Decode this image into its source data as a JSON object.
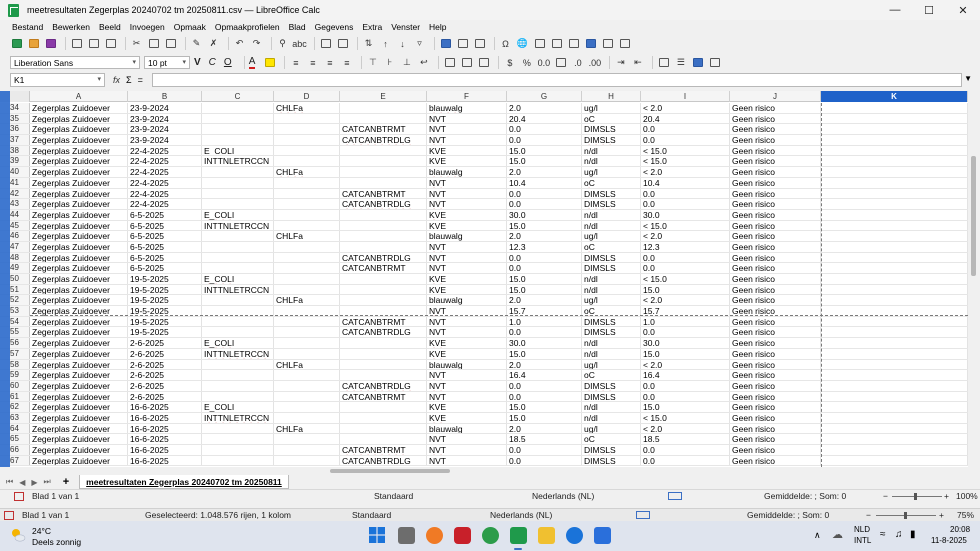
{
  "window": {
    "title": "meetresultaten Zegerplas 20240702 tm 20250811.csv — LibreOffice Calc",
    "controls": {
      "minimize": "—",
      "maximize": "☐",
      "close": "✕"
    }
  },
  "menubar": [
    "Bestand",
    "Bewerken",
    "Beeld",
    "Invoegen",
    "Opmaak",
    "Opmaakprofielen",
    "Blad",
    "Gegevens",
    "Extra",
    "Venster",
    "Help"
  ],
  "toolbar": {
    "font_name": "Liberation Sans",
    "font_size": "10 pt",
    "bold": "V",
    "italic": "C",
    "underline": "O",
    "font_color_letter": "A"
  },
  "formula_bar": {
    "name_box": "K1",
    "fx": "fx",
    "sigma": "Σ",
    "equals": "=",
    "content": ""
  },
  "grid": {
    "columns": [
      "A",
      "B",
      "C",
      "D",
      "E",
      "F",
      "G",
      "H",
      "I",
      "J",
      "K"
    ],
    "selected_column": "K",
    "rows": [
      {
        "n": "34",
        "a": "Zegerplas Zuidoever",
        "b": "23-9-2024",
        "c": "",
        "d": "CHLFa",
        "e": "",
        "f": "blauwalg",
        "g": "2.0",
        "h": "ug/l",
        "i": "< 2.0",
        "j": "Geen risico"
      },
      {
        "n": "35",
        "a": "Zegerplas Zuidoever",
        "b": "23-9-2024",
        "c": "",
        "d": "",
        "e": "",
        "f": "NVT",
        "g": "20.4",
        "h": "oC",
        "i": "20.4",
        "j": "Geen risico"
      },
      {
        "n": "36",
        "a": "Zegerplas Zuidoever",
        "b": "23-9-2024",
        "c": "",
        "d": "",
        "e": "CATCANBTRMT",
        "f": "NVT",
        "g": "0.0",
        "h": "DIMSLS",
        "i": "0.0",
        "j": "Geen risico"
      },
      {
        "n": "37",
        "a": "Zegerplas Zuidoever",
        "b": "23-9-2024",
        "c": "",
        "d": "",
        "e": "CATCANBTRDLG",
        "f": "NVT",
        "g": "0.0",
        "h": "DIMSLS",
        "i": "0.0",
        "j": "Geen risico"
      },
      {
        "n": "38",
        "a": "Zegerplas Zuidoever",
        "b": "22-4-2025",
        "c": "E_COLI",
        "d": "",
        "e": "",
        "f": "KVE",
        "g": "15.0",
        "h": "n/dl",
        "i": "< 15.0",
        "j": "Geen risico"
      },
      {
        "n": "39",
        "a": "Zegerplas Zuidoever",
        "b": "22-4-2025",
        "c": "INTTNLETRCCN",
        "d": "",
        "e": "",
        "f": "KVE",
        "g": "15.0",
        "h": "n/dl",
        "i": "< 15.0",
        "j": "Geen risico"
      },
      {
        "n": "40",
        "a": "Zegerplas Zuidoever",
        "b": "22-4-2025",
        "c": "",
        "d": "CHLFa",
        "e": "",
        "f": "blauwalg",
        "g": "2.0",
        "h": "ug/l",
        "i": "< 2.0",
        "j": "Geen risico"
      },
      {
        "n": "41",
        "a": "Zegerplas Zuidoever",
        "b": "22-4-2025",
        "c": "",
        "d": "",
        "e": "",
        "f": "NVT",
        "g": "10.4",
        "h": "oC",
        "i": "10.4",
        "j": "Geen risico"
      },
      {
        "n": "42",
        "a": "Zegerplas Zuidoever",
        "b": "22-4-2025",
        "c": "",
        "d": "",
        "e": "CATCANBTRMT",
        "f": "NVT",
        "g": "0.0",
        "h": "DIMSLS",
        "i": "0.0",
        "j": "Geen risico"
      },
      {
        "n": "43",
        "a": "Zegerplas Zuidoever",
        "b": "22-4-2025",
        "c": "",
        "d": "",
        "e": "CATCANBTRDLG",
        "f": "NVT",
        "g": "0.0",
        "h": "DIMSLS",
        "i": "0.0",
        "j": "Geen risico"
      },
      {
        "n": "44",
        "a": "Zegerplas Zuidoever",
        "b": "6-5-2025",
        "c": "E_COLI",
        "d": "",
        "e": "",
        "f": "KVE",
        "g": "30.0",
        "h": "n/dl",
        "i": "30.0",
        "j": "Geen risico"
      },
      {
        "n": "45",
        "a": "Zegerplas Zuidoever",
        "b": "6-5-2025",
        "c": "INTTNLETRCCN",
        "d": "",
        "e": "",
        "f": "KVE",
        "g": "15.0",
        "h": "n/dl",
        "i": "< 15.0",
        "j": "Geen risico"
      },
      {
        "n": "46",
        "a": "Zegerplas Zuidoever",
        "b": "6-5-2025",
        "c": "",
        "d": "CHLFa",
        "e": "",
        "f": "blauwalg",
        "g": "2.0",
        "h": "ug/l",
        "i": "< 2.0",
        "j": "Geen risico"
      },
      {
        "n": "47",
        "a": "Zegerplas Zuidoever",
        "b": "6-5-2025",
        "c": "",
        "d": "",
        "e": "",
        "f": "NVT",
        "g": "12.3",
        "h": "oC",
        "i": "12.3",
        "j": "Geen risico"
      },
      {
        "n": "48",
        "a": "Zegerplas Zuidoever",
        "b": "6-5-2025",
        "c": "",
        "d": "",
        "e": "CATCANBTRDLG",
        "f": "NVT",
        "g": "0.0",
        "h": "DIMSLS",
        "i": "0.0",
        "j": "Geen risico"
      },
      {
        "n": "49",
        "a": "Zegerplas Zuidoever",
        "b": "6-5-2025",
        "c": "",
        "d": "",
        "e": "CATCANBTRMT",
        "f": "NVT",
        "g": "0.0",
        "h": "DIMSLS",
        "i": "0.0",
        "j": "Geen risico"
      },
      {
        "n": "50",
        "a": "Zegerplas Zuidoever",
        "b": "19-5-2025",
        "c": "E_COLI",
        "d": "",
        "e": "",
        "f": "KVE",
        "g": "15.0",
        "h": "n/dl",
        "i": "< 15.0",
        "j": "Geen risico"
      },
      {
        "n": "51",
        "a": "Zegerplas Zuidoever",
        "b": "19-5-2025",
        "c": "INTTNLETRCCN",
        "d": "",
        "e": "",
        "f": "KVE",
        "g": "15.0",
        "h": "n/dl",
        "i": "15.0",
        "j": "Geen risico"
      },
      {
        "n": "52",
        "a": "Zegerplas Zuidoever",
        "b": "19-5-2025",
        "c": "",
        "d": "CHLFa",
        "e": "",
        "f": "blauwalg",
        "g": "2.0",
        "h": "ug/l",
        "i": "< 2.0",
        "j": "Geen risico"
      },
      {
        "n": "53",
        "a": "Zegerplas Zuidoever",
        "b": "19-5-2025",
        "c": "",
        "d": "",
        "e": "",
        "f": "NVT",
        "g": "15.7",
        "h": "oC",
        "i": "15.7",
        "j": "Geen risico"
      },
      {
        "n": "54",
        "a": "Zegerplas Zuidoever",
        "b": "19-5-2025",
        "c": "",
        "d": "",
        "e": "CATCANBTRMT",
        "f": "NVT",
        "g": "1.0",
        "h": "DIMSLS",
        "i": "1.0",
        "j": "Geen risico"
      },
      {
        "n": "55",
        "a": "Zegerplas Zuidoever",
        "b": "19-5-2025",
        "c": "",
        "d": "",
        "e": "CATCANBTRDLG",
        "f": "NVT",
        "g": "0.0",
        "h": "DIMSLS",
        "i": "0.0",
        "j": "Geen risico"
      },
      {
        "n": "56",
        "a": "Zegerplas Zuidoever",
        "b": "2-6-2025",
        "c": "E_COLI",
        "d": "",
        "e": "",
        "f": "KVE",
        "g": "30.0",
        "h": "n/dl",
        "i": "30.0",
        "j": "Geen risico"
      },
      {
        "n": "57",
        "a": "Zegerplas Zuidoever",
        "b": "2-6-2025",
        "c": "INTTNLETRCCN",
        "d": "",
        "e": "",
        "f": "KVE",
        "g": "15.0",
        "h": "n/dl",
        "i": "15.0",
        "j": "Geen risico"
      },
      {
        "n": "58",
        "a": "Zegerplas Zuidoever",
        "b": "2-6-2025",
        "c": "",
        "d": "CHLFa",
        "e": "",
        "f": "blauwalg",
        "g": "2.0",
        "h": "ug/l",
        "i": "< 2.0",
        "j": "Geen risico"
      },
      {
        "n": "59",
        "a": "Zegerplas Zuidoever",
        "b": "2-6-2025",
        "c": "",
        "d": "",
        "e": "",
        "f": "NVT",
        "g": "16.4",
        "h": "oC",
        "i": "16.4",
        "j": "Geen risico"
      },
      {
        "n": "60",
        "a": "Zegerplas Zuidoever",
        "b": "2-6-2025",
        "c": "",
        "d": "",
        "e": "CATCANBTRDLG",
        "f": "NVT",
        "g": "0.0",
        "h": "DIMSLS",
        "i": "0.0",
        "j": "Geen risico"
      },
      {
        "n": "61",
        "a": "Zegerplas Zuidoever",
        "b": "2-6-2025",
        "c": "",
        "d": "",
        "e": "CATCANBTRMT",
        "f": "NVT",
        "g": "0.0",
        "h": "DIMSLS",
        "i": "0.0",
        "j": "Geen risico"
      },
      {
        "n": "62",
        "a": "Zegerplas Zuidoever",
        "b": "16-6-2025",
        "c": "E_COLI",
        "d": "",
        "e": "",
        "f": "KVE",
        "g": "15.0",
        "h": "n/dl",
        "i": "15.0",
        "j": "Geen risico"
      },
      {
        "n": "63",
        "a": "Zegerplas Zuidoever",
        "b": "16-6-2025",
        "c": "INTTNLETRCCN",
        "d": "",
        "e": "",
        "f": "KVE",
        "g": "15.0",
        "h": "n/dl",
        "i": "< 15.0",
        "j": "Geen risico"
      },
      {
        "n": "64",
        "a": "Zegerplas Zuidoever",
        "b": "16-6-2025",
        "c": "",
        "d": "CHLFa",
        "e": "",
        "f": "blauwalg",
        "g": "2.0",
        "h": "ug/l",
        "i": "< 2.0",
        "j": "Geen risico"
      },
      {
        "n": "65",
        "a": "Zegerplas Zuidoever",
        "b": "16-6-2025",
        "c": "",
        "d": "",
        "e": "",
        "f": "NVT",
        "g": "18.5",
        "h": "oC",
        "i": "18.5",
        "j": "Geen risico"
      },
      {
        "n": "66",
        "a": "Zegerplas Zuidoever",
        "b": "16-6-2025",
        "c": "",
        "d": "",
        "e": "CATCANBTRMT",
        "f": "NVT",
        "g": "0.0",
        "h": "DIMSLS",
        "i": "0.0",
        "j": "Geen risico"
      },
      {
        "n": "67",
        "a": "Zegerplas Zuidoever",
        "b": "16-6-2025",
        "c": "",
        "d": "",
        "e": "CATCANBTRDLG",
        "f": "NVT",
        "g": "0.0",
        "h": "DIMSLS",
        "i": "0.0",
        "j": "Geen risico"
      }
    ]
  },
  "sheet_tabs": {
    "add": "+",
    "active_tab": "meetresultaten Zegerplas 20240702 tm 20250811",
    "nav": [
      "⏮",
      "◀",
      "▶",
      "⏭"
    ]
  },
  "status_bar_1": {
    "sheet": "Blad 1 van 1",
    "style": "Standaard",
    "language": "Nederlands (NL)",
    "sum": "Gemiddelde: ; Som: 0",
    "zoom": "100%",
    "minus": "−",
    "plus": "+"
  },
  "status_bar_2": {
    "sheet": "Blad 1 van 1",
    "selection": "Geselecteerd: 1.048.576 rijen, 1 kolom",
    "style": "Standaard",
    "language": "Nederlands (NL)",
    "sum": "Gemiddelde: ; Som: 0",
    "zoom": "75%",
    "minus": "−",
    "plus": "+"
  },
  "taskbar": {
    "temperature": "24°C",
    "weather": "Deels zonnig",
    "lang1": "NLD",
    "lang2": "INTL",
    "time": "20:08",
    "date": "11-8-2025",
    "chevron": "∧"
  },
  "colors": {
    "selection_blue": "#1f62c9",
    "calc_green": "#1f9a4b"
  }
}
